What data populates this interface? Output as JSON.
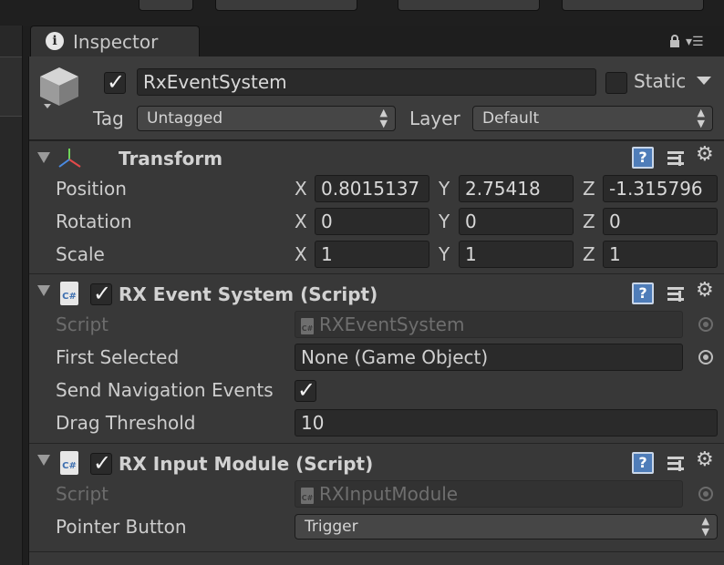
{
  "inspector_tab": {
    "title": "Inspector"
  },
  "game_object": {
    "active": true,
    "name": "RxEventSystem",
    "static_label": "Static",
    "static": false,
    "tag_label": "Tag",
    "tag_value": "Untagged",
    "layer_label": "Layer",
    "layer_value": "Default"
  },
  "transform": {
    "title": "Transform",
    "position_label": "Position",
    "rotation_label": "Rotation",
    "scale_label": "Scale",
    "axis_x": "X",
    "axis_y": "Y",
    "axis_z": "Z",
    "position": {
      "x": "0.8015137",
      "y": "2.75418",
      "z": "-1.315796"
    },
    "rotation": {
      "x": "0",
      "y": "0",
      "z": "0"
    },
    "scale": {
      "x": "1",
      "y": "1",
      "z": "1"
    }
  },
  "event_system": {
    "title": "RX Event System (Script)",
    "enabled": true,
    "script_label": "Script",
    "script_value": "RXEventSystem",
    "first_selected_label": "First Selected",
    "first_selected_value": "None (Game Object)",
    "send_nav_label": "Send Navigation Events",
    "send_nav_value": true,
    "drag_threshold_label": "Drag Threshold",
    "drag_threshold_value": "10"
  },
  "input_module": {
    "title": "RX Input Module (Script)",
    "enabled": true,
    "script_label": "Script",
    "script_value": "RXInputModule",
    "pointer_button_label": "Pointer Button",
    "pointer_button_value": "Trigger"
  },
  "icons": {
    "script": "C#",
    "help": "?",
    "info": "i"
  }
}
